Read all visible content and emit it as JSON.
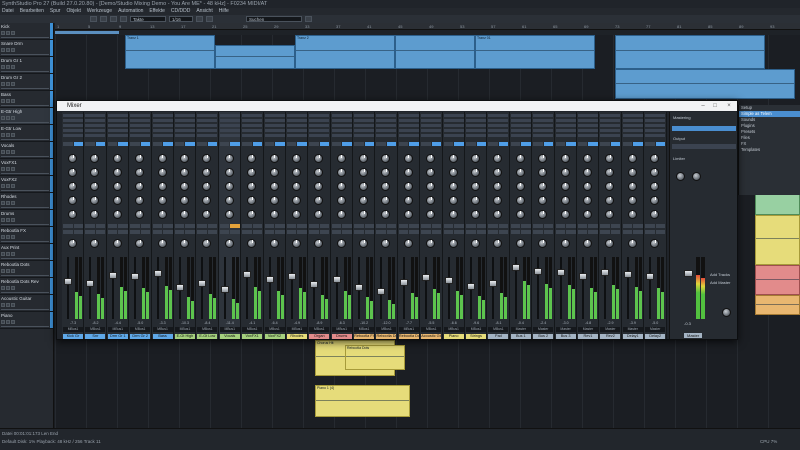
{
  "window": {
    "title": "SynthStudio Pro 27 (Build 27.0.20.80) - [Demo/Studio Mixing Demo - You Are ME* - 48 kHz] - F0234 MIDI/AT"
  },
  "menu": [
    "Datei",
    "Bearbeiten",
    "Spur",
    "Objekt",
    "Werkzeuge",
    "Automation",
    "Effekte",
    "CD/DDD",
    "Ansicht",
    "Hilfe"
  ],
  "toolbar": {
    "zoom_mode": "Takte",
    "snap": "1/16",
    "search_placeholder": "Suchen"
  },
  "ruler": [
    "1",
    "5",
    "9",
    "13",
    "17",
    "21",
    "25",
    "29",
    "33",
    "37",
    "41",
    "45",
    "49",
    "53",
    "57",
    "61",
    "65",
    "69",
    "73",
    "77",
    "81",
    "85",
    "89",
    "93",
    "97"
  ],
  "tracks": [
    {
      "name": "Kick"
    },
    {
      "name": "Snare Drm"
    },
    {
      "name": "Drum Gr 1"
    },
    {
      "name": "Drum Gr 2"
    },
    {
      "name": "Bass"
    },
    {
      "name": "E-Gtr High"
    },
    {
      "name": "E-Gtr Low"
    },
    {
      "name": "Vocals"
    },
    {
      "name": "VoxFX1"
    },
    {
      "name": "VoxFX2"
    },
    {
      "name": "Rhodes"
    },
    {
      "name": "Drums"
    },
    {
      "name": "Rebootla FX"
    },
    {
      "name": "Aux Print"
    },
    {
      "name": "Rebootla Dots"
    },
    {
      "name": "Rebootla Dots Rev"
    },
    {
      "name": "Acoustic Guitar"
    },
    {
      "name": "Piano"
    }
  ],
  "arranger": {
    "clip_labels": [
      "Tranz 1",
      "Tranz 2",
      "Tranz 01",
      "Chorus Hit",
      "Rebootla Dots",
      "Piano 1 (4)"
    ]
  },
  "mixer": {
    "title": "Mixer",
    "strips": [
      {
        "name": "Kick Gr",
        "level": "-7.3",
        "out": "MBus1",
        "color": "#5fa8e8"
      },
      {
        "name": "Snr",
        "level": "-8.2",
        "out": "MBus1",
        "color": "#5fa8e8"
      },
      {
        "name": "Drm Gr 1",
        "level": "-4.4",
        "out": "MBus1",
        "color": "#5fa8e8"
      },
      {
        "name": "Drm Gr 2",
        "level": "-5.0",
        "out": "MBus1",
        "color": "#5fa8e8"
      },
      {
        "name": "Bass",
        "level": "-3.3",
        "out": "MBus1",
        "color": "#5fa8e8"
      },
      {
        "name": "E-Gt High",
        "level": "-10.3",
        "out": "MBus1",
        "color": "#a5d07e"
      },
      {
        "name": "E-Gt Low",
        "level": "-8.4",
        "out": "MBus1",
        "color": "#a5d07e"
      },
      {
        "name": "Vocals",
        "level": "-11.4",
        "out": "MBus1",
        "color": "#a5d07e"
      },
      {
        "name": "VoxFX1",
        "level": "-4.1",
        "out": "MBus1",
        "color": "#a5d07e"
      },
      {
        "name": "VoxFX2",
        "level": "-6.4",
        "out": "MBus1",
        "color": "#a5d07e"
      },
      {
        "name": "Rhodes",
        "level": "-4.9",
        "out": "MBus1",
        "color": "#e6dc7a"
      },
      {
        "name": "Organ",
        "level": "-8.9",
        "out": "MBus1",
        "color": "#e28b8b"
      },
      {
        "name": "Drums",
        "level": "-6.3",
        "out": "MBus1",
        "color": "#e28b8b"
      },
      {
        "name": "Rebootla FX",
        "level": "-10.2",
        "out": "MBus1",
        "color": "#e9b770"
      },
      {
        "name": "Rebootla Dots",
        "level": "-12.0",
        "out": "MBus1",
        "color": "#e9b770"
      },
      {
        "name": "Rebootla Dots R",
        "level": "-7.7",
        "out": "MBus1",
        "color": "#e9b770"
      },
      {
        "name": "Acoustic Gtr",
        "level": "-5.5",
        "out": "MBus1",
        "color": "#e9b770"
      },
      {
        "name": "Piano",
        "level": "-6.6",
        "out": "MBus1",
        "color": "#e6dc7a"
      },
      {
        "name": "Strings",
        "level": "-9.6",
        "out": "MBus1",
        "color": "#e6dc7a"
      },
      {
        "name": "Pad",
        "level": "-8.1",
        "out": "MBus1",
        "color": "#a4b4c4"
      },
      {
        "name": "Bus 1",
        "level": "-0.4",
        "out": "Master",
        "color": "#a4b4c4"
      },
      {
        "name": "Bus 2",
        "level": "-2.4",
        "out": "Master",
        "color": "#a4b4c4"
      },
      {
        "name": "Bus 3",
        "level": "-3.0",
        "out": "Master",
        "color": "#a4b4c4"
      },
      {
        "name": "Rev1",
        "level": "-4.8",
        "out": "Master",
        "color": "#a4b4c4"
      },
      {
        "name": "Rev2",
        "level": "-2.9",
        "out": "Master",
        "color": "#a4b4c4"
      },
      {
        "name": "Delay1",
        "level": "-3.9",
        "out": "Master",
        "color": "#a4b4c4"
      },
      {
        "name": "Delay2",
        "level": "-5.0",
        "out": "Master",
        "color": "#a4b4c4"
      }
    ],
    "master": {
      "name": "Master",
      "label_mastering": "Mastering",
      "label_output": "Output",
      "label_limiter": "Limiter",
      "label_more_tracks": "Add Tracks",
      "label_add_master": "Add Master",
      "level": "-0.3"
    }
  },
  "browser": {
    "rows": [
      "Setup",
      "Simple as Telem",
      "Sounds",
      "Plugins",
      "Presets",
      "Files",
      "FX",
      "Templates"
    ]
  },
  "status": {
    "row1": "Datei      00:01:01:173      Len      End",
    "row2": "Default      Disk: 1%      Playback: 48 kHz / 256      Track 11",
    "cpu_label": "CPU 7%"
  }
}
